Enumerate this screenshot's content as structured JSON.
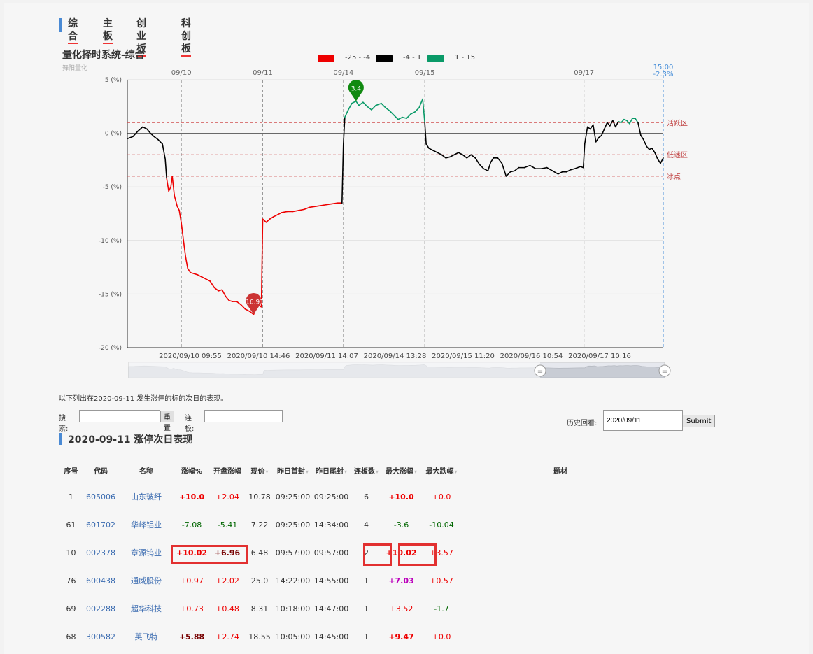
{
  "tabs": [
    "综合",
    "主板",
    "创业板",
    "科创板"
  ],
  "chart": {
    "title": "量化择时系统-综合",
    "subtitle": "舞阳量化",
    "legend": [
      {
        "color": "#ee0000",
        "label": "-25 - -4"
      },
      {
        "color": "#000000",
        "label": "-4 - 1"
      },
      {
        "color": "#0a9a68",
        "label": "1 - 15"
      }
    ],
    "top_dates": [
      "09/10",
      "09/11",
      "09/14",
      "09/15",
      "09/17"
    ],
    "current": {
      "time": "15:00",
      "value": "-2.3%"
    },
    "y_ticks": [
      "5 (%)",
      "0 (%)",
      "-5 (%)",
      "-10 (%)",
      "-15 (%)",
      "-20 (%)"
    ],
    "x_labels": [
      "2020/09/10 09:55",
      "2020/09/10 14:46",
      "2020/09/11 14:07",
      "2020/09/14 13:28",
      "2020/09/15 11:20",
      "2020/09/16 10:54",
      "2020/09/17 10:16"
    ],
    "zones": [
      {
        "label": "活跃区",
        "value": 1
      },
      {
        "label": "低迷区",
        "value": -2
      },
      {
        "label": "冰点",
        "value": -4
      }
    ],
    "max_marker": "3.4",
    "min_marker": "-16.91"
  },
  "chart_data": {
    "type": "line",
    "ylim": [
      -20,
      5
    ],
    "series_points": [
      [
        0,
        -0.5
      ],
      [
        8,
        -0.3
      ],
      [
        15,
        0.2
      ],
      [
        22,
        0.6
      ],
      [
        28,
        0.4
      ],
      [
        33,
        0
      ],
      [
        38,
        -0.3
      ],
      [
        44,
        -0.6
      ],
      [
        50,
        -1.0
      ],
      [
        54,
        -2.4
      ],
      [
        56,
        -4.2
      ],
      [
        59,
        -5.4
      ],
      [
        62,
        -5.0
      ],
      [
        64,
        -4.0
      ],
      [
        67,
        -5.8
      ],
      [
        71,
        -6.8
      ],
      [
        74,
        -7.2
      ],
      [
        77,
        -8.4
      ],
      [
        80,
        -10.0
      ],
      [
        83,
        -11.5
      ],
      [
        86,
        -12.6
      ],
      [
        90,
        -13.0
      ],
      [
        95,
        -13.1
      ],
      [
        100,
        -13.2
      ],
      [
        106,
        -13.4
      ],
      [
        112,
        -13.6
      ],
      [
        118,
        -13.8
      ],
      [
        124,
        -14.4
      ],
      [
        130,
        -14.7
      ],
      [
        135,
        -14.6
      ],
      [
        140,
        -15.2
      ],
      [
        145,
        -15.6
      ],
      [
        150,
        -15.7
      ],
      [
        156,
        -15.7
      ],
      [
        162,
        -16.0
      ],
      [
        168,
        -16.4
      ],
      [
        174,
        -16.6
      ],
      [
        180,
        -16.9
      ],
      [
        186,
        -16.0
      ],
      [
        191,
        -16.2
      ],
      [
        193,
        -8.0
      ],
      [
        198,
        -8.3
      ],
      [
        203,
        -8.0
      ],
      [
        208,
        -7.8
      ],
      [
        214,
        -7.6
      ],
      [
        220,
        -7.4
      ],
      [
        228,
        -7.3
      ],
      [
        236,
        -7.3
      ],
      [
        244,
        -7.2
      ],
      [
        252,
        -7.1
      ],
      [
        260,
        -6.9
      ],
      [
        270,
        -6.8
      ],
      [
        280,
        -6.7
      ],
      [
        290,
        -6.6
      ],
      [
        300,
        -6.5
      ],
      [
        306,
        -6.5
      ],
      [
        308,
        -1.0
      ],
      [
        310,
        1.5
      ],
      [
        315,
        2.2
      ],
      [
        320,
        2.8
      ],
      [
        326,
        3.0
      ],
      [
        330,
        2.6
      ],
      [
        336,
        2.9
      ],
      [
        342,
        2.5
      ],
      [
        348,
        2.2
      ],
      [
        354,
        2.6
      ],
      [
        362,
        2.8
      ],
      [
        368,
        2.4
      ],
      [
        374,
        2.1
      ],
      [
        380,
        1.7
      ],
      [
        386,
        1.3
      ],
      [
        392,
        1.5
      ],
      [
        398,
        1.4
      ],
      [
        404,
        1.8
      ],
      [
        410,
        2.0
      ],
      [
        416,
        2.4
      ],
      [
        421,
        3.2
      ],
      [
        424,
        1.0
      ],
      [
        426,
        -1.0
      ],
      [
        430,
        -1.4
      ],
      [
        436,
        -1.6
      ],
      [
        442,
        -1.8
      ],
      [
        448,
        -2.0
      ],
      [
        454,
        -2.3
      ],
      [
        460,
        -2.2
      ],
      [
        466,
        -2.0
      ],
      [
        472,
        -1.8
      ],
      [
        478,
        -2.0
      ],
      [
        484,
        -2.3
      ],
      [
        490,
        -2.0
      ],
      [
        496,
        -2.3
      ],
      [
        502,
        -2.9
      ],
      [
        508,
        -3.3
      ],
      [
        514,
        -3.5
      ],
      [
        518,
        -2.7
      ],
      [
        522,
        -2.3
      ],
      [
        528,
        -2.3
      ],
      [
        534,
        -2.8
      ],
      [
        540,
        -4.0
      ],
      [
        546,
        -3.6
      ],
      [
        552,
        -3.5
      ],
      [
        558,
        -3.2
      ],
      [
        566,
        -3.2
      ],
      [
        574,
        -3.0
      ],
      [
        582,
        -3.3
      ],
      [
        590,
        -3.3
      ],
      [
        598,
        -3.2
      ],
      [
        606,
        -3.5
      ],
      [
        614,
        -3.8
      ],
      [
        620,
        -3.6
      ],
      [
        626,
        -3.6
      ],
      [
        632,
        -3.4
      ],
      [
        638,
        -3.3
      ],
      [
        646,
        -3.1
      ],
      [
        650,
        -3.2
      ],
      [
        652,
        -1.0
      ],
      [
        656,
        0.6
      ],
      [
        660,
        0.4
      ],
      [
        664,
        0.8
      ],
      [
        668,
        -0.8
      ],
      [
        672,
        -0.4
      ],
      [
        676,
        -0.2
      ],
      [
        680,
        0.4
      ],
      [
        684,
        1.0
      ],
      [
        688,
        0.7
      ],
      [
        692,
        1.2
      ],
      [
        696,
        0.6
      ],
      [
        700,
        1.1
      ],
      [
        704,
        1.0
      ],
      [
        708,
        1.3
      ],
      [
        712,
        1.2
      ],
      [
        716,
        0.9
      ],
      [
        720,
        1.4
      ],
      [
        724,
        1.4
      ],
      [
        728,
        1.0
      ],
      [
        732,
        -0.2
      ],
      [
        736,
        -0.6
      ],
      [
        740,
        -1.2
      ],
      [
        744,
        -1.5
      ],
      [
        748,
        -1.4
      ],
      [
        752,
        -1.8
      ],
      [
        756,
        -2.4
      ],
      [
        760,
        -2.8
      ],
      [
        764,
        -2.3
      ]
    ]
  },
  "info_text": "以下列出在2020-09-11 发生涨停的标的次日的表现。",
  "search": {
    "label": "搜索:",
    "reset": "重置",
    "lianban_label": "连板:"
  },
  "history": {
    "label": "历史回看:",
    "date": "2020/09/11",
    "submit": "Submit"
  },
  "section_title": "2020-09-11 涨停次日表现",
  "table": {
    "headers": [
      "序号",
      "代码",
      "名称",
      "涨幅%",
      "开盘涨幅",
      "现价",
      "昨日首封",
      "昨日尾封",
      "连板数",
      "最大涨幅",
      "最大跌幅",
      "题材"
    ],
    "sortable": [
      false,
      false,
      false,
      false,
      false,
      true,
      true,
      true,
      true,
      true,
      true,
      false
    ],
    "rows": [
      {
        "no": "1",
        "code": "605006",
        "name": "山东玻纤",
        "chg": "+10.0",
        "open": "+2.04",
        "price": "10.78",
        "first": "09:25:00",
        "last": "09:25:00",
        "lb": "6",
        "max": "+10.0",
        "min": "+0.0"
      },
      {
        "no": "61",
        "code": "601702",
        "name": "华峰铝业",
        "chg": "-7.08",
        "open": "-5.41",
        "price": "7.22",
        "first": "09:25:00",
        "last": "14:34:00",
        "lb": "4",
        "max": "-3.6",
        "min": "-10.04"
      },
      {
        "no": "10",
        "code": "002378",
        "name": "章源钨业",
        "chg": "+10.02",
        "open": "+6.96",
        "price": "6.48",
        "first": "09:57:00",
        "last": "09:57:00",
        "lb": "2",
        "max": "+10.02",
        "min": "+3.57"
      },
      {
        "no": "76",
        "code": "600438",
        "name": "通威股份",
        "chg": "+0.97",
        "open": "+2.02",
        "price": "25.0",
        "first": "14:22:00",
        "last": "14:55:00",
        "lb": "1",
        "max": "+7.03",
        "min": "+0.57"
      },
      {
        "no": "69",
        "code": "002288",
        "name": "超华科技",
        "chg": "+0.73",
        "open": "+0.48",
        "price": "8.31",
        "first": "10:18:00",
        "last": "14:47:00",
        "lb": "1",
        "max": "+3.52",
        "min": "-1.7"
      },
      {
        "no": "68",
        "code": "300582",
        "name": "英飞特",
        "chg": "+5.88",
        "open": "+2.74",
        "price": "18.55",
        "first": "10:05:00",
        "last": "14:45:00",
        "lb": "1",
        "max": "+9.47",
        "min": "+0.0"
      }
    ]
  }
}
